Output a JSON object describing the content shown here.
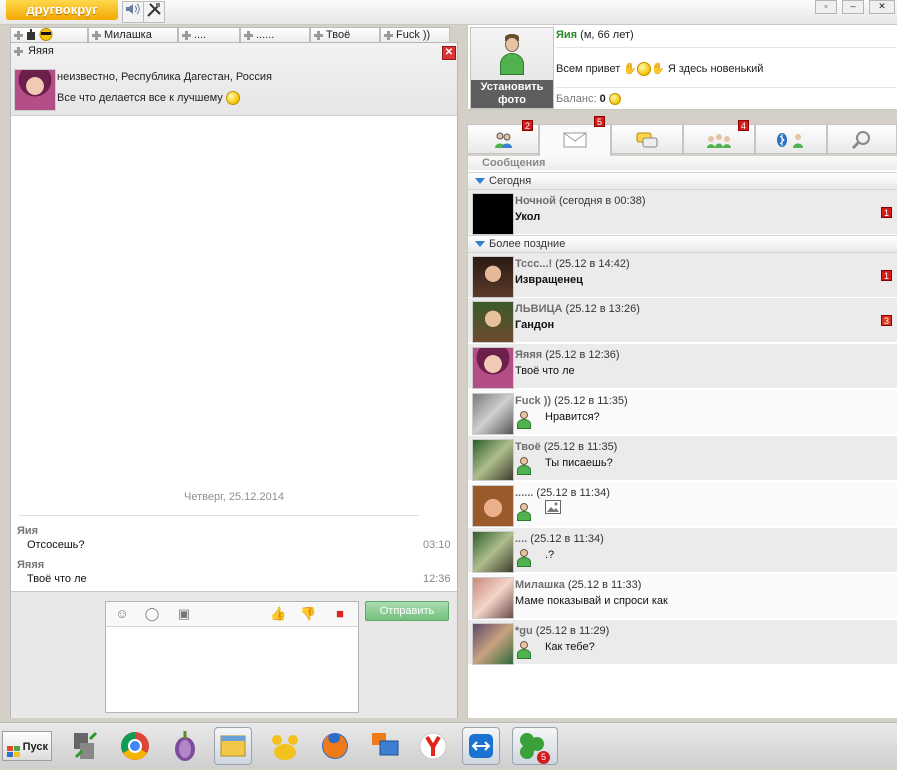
{
  "app": {
    "logo_text": "другвокруг",
    "topbar_icons": [
      "speaker-icon",
      "tools-icon"
    ]
  },
  "chat_tabs": [
    {
      "label": "",
      "icon": "smiley-sunglasses"
    },
    {
      "label": "Милашка"
    },
    {
      "label": "...."
    },
    {
      "label": "......"
    },
    {
      "label": "Твоё"
    },
    {
      "label": "Fuck ))"
    }
  ],
  "chat": {
    "title": "Яяяя",
    "location": "неизвестно, Республика Дагестан, Россия",
    "status": "Все что делается все к лучшему",
    "date_separator": "Четверг, 25.12.2014",
    "messages": [
      {
        "sender": "Яия",
        "text": "Отсосешь?",
        "time": "03:10"
      },
      {
        "sender": "Яяяя",
        "text": "Твоё что ле",
        "time": "12:36"
      }
    ],
    "send_label": "Отправить"
  },
  "profile": {
    "set_photo_label": "Установить фото",
    "name": "Яия",
    "meta": "(м, 66 лет)",
    "greeting": "Всем привет",
    "greeting_tail": "Я здесь новенький",
    "balance_label": "Баланс:",
    "balance_value": "0"
  },
  "right_tabs": [
    {
      "icon": "people-icon",
      "badge": "2"
    },
    {
      "icon": "envelope-icon",
      "badge": "5",
      "active": true
    },
    {
      "icon": "chat-bubble-icon",
      "badge": ""
    },
    {
      "icon": "group-chat-icon",
      "badge": "4"
    },
    {
      "icon": "bluetooth-people-icon",
      "badge": ""
    },
    {
      "icon": "search-icon",
      "badge": ""
    }
  ],
  "messages_panel": {
    "title": "Сообщения",
    "group_today": "Сегодня",
    "group_older": "Более поздние",
    "today": [
      {
        "name": "Ночной",
        "when": "(сегодня в 00:38)",
        "text": "Укол",
        "unread": "1"
      }
    ],
    "older": [
      {
        "name": "Тссс...!",
        "when": "(25.12 в 14:42)",
        "text": "Извращенец",
        "unread": "1",
        "bold": true
      },
      {
        "name": "ЛЬВИЦА",
        "when": "(25.12 в 13:26)",
        "text": "Гандон",
        "unread": "3",
        "bold": true
      },
      {
        "name": "Яяяя",
        "when": "(25.12 в 12:36)",
        "text": "Твоё что ле",
        "unread": ""
      },
      {
        "name": "Fuck ))",
        "when": "(25.12 в 11:35)",
        "text": "Нравится?",
        "unread": "",
        "mine": true
      },
      {
        "name": "Твоё",
        "when": "(25.12 в 11:35)",
        "text": "Ты писаешь?",
        "unread": "",
        "mine": true
      },
      {
        "name": "......",
        "when": "(25.12 в 11:34)",
        "text": "",
        "unread": "",
        "mine": true,
        "image": true
      },
      {
        "name": "....",
        "when": "(25.12 в 11:34)",
        "text": ".?",
        "unread": "",
        "mine": true
      },
      {
        "name": "Милашка",
        "when": "(25.12 в 11:33)",
        "text": "Маме показывай и спроси как",
        "unread": ""
      },
      {
        "name": "*gu",
        "when": "(25.12 в 11:29)",
        "text": "Как тебе?",
        "unread": "",
        "mine": true
      }
    ]
  },
  "taskbar": {
    "start_label": "Пуск",
    "apps": [
      "network-icon",
      "chrome-icon",
      "tor-icon",
      "file-manager-icon",
      "paw-icon",
      "firefox-icon",
      "remote-desktop-icon",
      "yandex-icon",
      "teamviewer-icon",
      "drugvokrug-icon"
    ],
    "drugvokrug_badge": "5"
  }
}
